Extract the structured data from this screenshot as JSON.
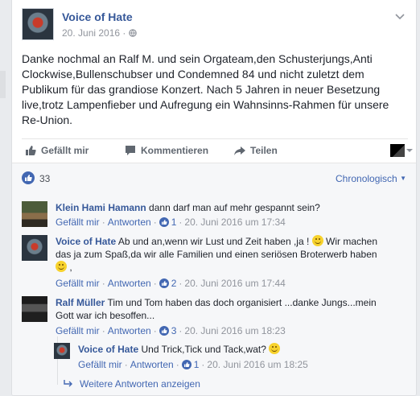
{
  "post": {
    "page_name": "Voice of Hate",
    "date": "20. Juni 2016",
    "separator": "·",
    "text": "Danke nochmal an Ralf M. und sein Orgateam,den Schusterjungs,Anti\nClockwise,Bullenschubser und Condemned 84 und nicht zuletzt dem\nPublikum für das grandiose Konzert. Nach 5 Jahren in neuer Besetzung\nlive,trotz Lampenfieber und Aufregung ein Wahnsinns-Rahmen für unsere\nRe-Union."
  },
  "actions": {
    "like": "Gefällt mir",
    "comment": "Kommentieren",
    "share": "Teilen"
  },
  "likes": {
    "count": "33",
    "sort_label": "Chronologisch"
  },
  "comments": [
    {
      "author": "Klein Hami Hamann",
      "text": "dann darf man auf mehr gespannt sein?",
      "like": "Gefällt mir",
      "reply": "Antworten",
      "likes": "1",
      "time": "20. Juni 2016 um 17:34"
    },
    {
      "author": "Voice of Hate",
      "text": "Ab und an,wenn wir Lust und Zeit haben ,ja !",
      "text2": "Wir machen",
      "text3": "das ja zum Spaß,da wir alle Familien und einen seriösen Broterwerb haben",
      "text4": ",",
      "like": "Gefällt mir",
      "reply": "Antworten",
      "likes": "2",
      "time": "20. Juni 2016 um 17:44"
    },
    {
      "author": "Ralf Müller",
      "text": "Tim und Tom haben das doch organisiert ...danke Jungs...mein",
      "text2": "Gott war ich besoffen...",
      "like": "Gefällt mir",
      "reply": "Antworten",
      "likes": "3",
      "time": "20. Juni 2016 um 18:23"
    }
  ],
  "reply": {
    "author": "Voice of Hate",
    "text": "Und Trick,Tick und Tack,wat?",
    "like": "Gefällt mir",
    "reply": "Antworten",
    "likes": "1",
    "time": "20. Juni 2016 um 18:25"
  },
  "more_replies": "Weitere Antworten anzeigen",
  "dot": "·",
  "colors": {
    "link": "#365899",
    "accent": "#4267b2",
    "meta": "#90949c"
  }
}
